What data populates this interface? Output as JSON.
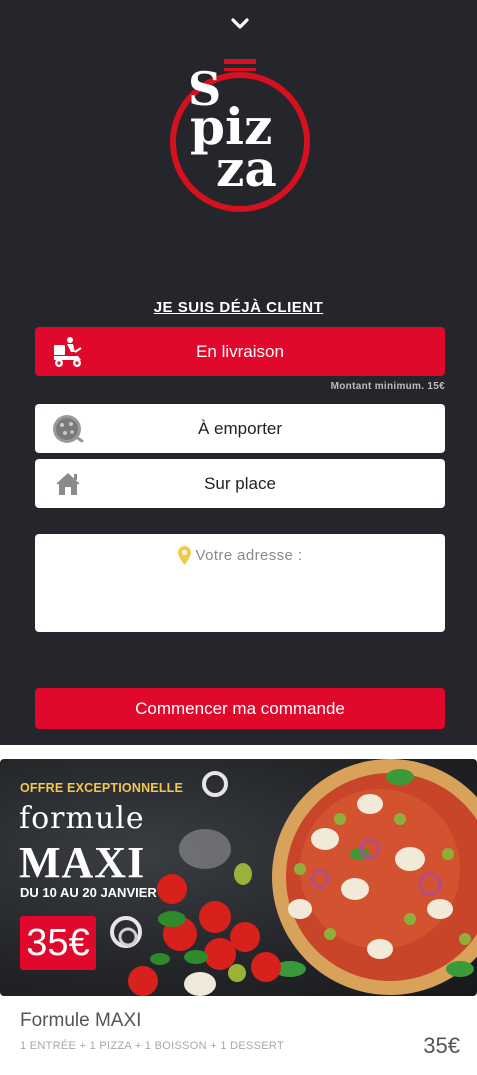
{
  "header": {
    "collapse_icon": "chevron-down-icon",
    "logo": {
      "letters": [
        "S",
        "piz",
        "za"
      ],
      "accent_color": "#d5101f"
    }
  },
  "order": {
    "client_link": "JE SUIS DÉJÀ CLIENT",
    "modes": [
      {
        "label": "En livraison",
        "icon": "delivery-scooter-icon",
        "selected": true
      },
      {
        "label": "À emporter",
        "icon": "pizza-box-icon",
        "selected": false
      },
      {
        "label": "Sur place",
        "icon": "home-icon",
        "selected": false
      }
    ],
    "minimum_note": "Montant minimum. 15€",
    "address_label": "Votre adresse :",
    "address_icon": "location-pin-icon",
    "start_button": "Commencer ma commande"
  },
  "promo": {
    "offer": "OFFRE EXCEPTIONNELLE",
    "formule": "formule",
    "maxi": "MAXI",
    "dates": "DU 10 AU 20 JANVIER",
    "price": "35€"
  },
  "product": {
    "name": "Formule MAXI",
    "description": "1 ENTRÉE + 1 PIZZA + 1 BOISSON + 1 DESSERT",
    "price": "35€"
  },
  "colors": {
    "background": "#25262b",
    "accent": "#e0082b",
    "offer_yellow": "#f2c94c"
  }
}
